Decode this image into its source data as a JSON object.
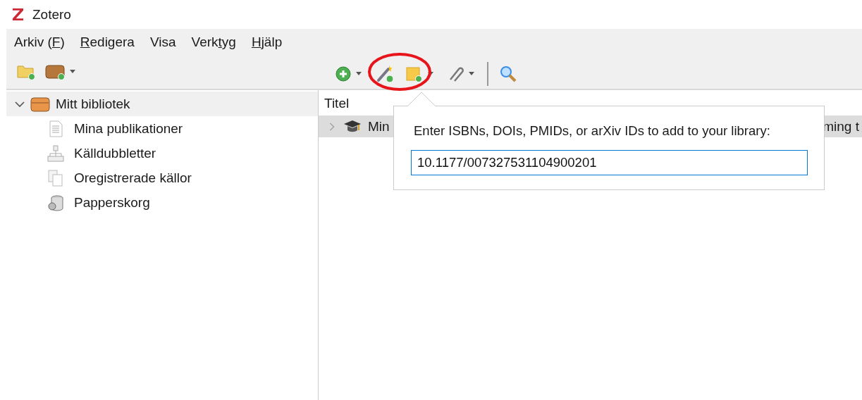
{
  "window": {
    "title": "Zotero"
  },
  "menu": [
    {
      "before": "Arkiv (",
      "key": "F",
      "after": ")"
    },
    {
      "key": "R",
      "after": "edigera"
    },
    {
      "before": "Visa"
    },
    {
      "before": "Verk",
      "key": "t",
      "after": "yg"
    },
    {
      "key": "H",
      "after": "jälp"
    }
  ],
  "sidebar": {
    "items": [
      {
        "label": "Mitt bibliotek",
        "kind": "library",
        "expanded": true,
        "selected": true,
        "children": [
          {
            "label": "Mina publikationer",
            "kind": "publications",
            "selected": false
          },
          {
            "label": "Källdubbletter",
            "kind": "duplicates",
            "selected": false
          },
          {
            "label": "Oregistrerade källor",
            "kind": "unfiled",
            "selected": false
          },
          {
            "label": "Papperskorg",
            "kind": "trash",
            "selected": false
          }
        ]
      }
    ]
  },
  "items": {
    "columns": [
      "Titel"
    ],
    "rows": [
      {
        "title_start": "Min",
        "title_end": "ming t",
        "selected": true,
        "expanded": false
      }
    ]
  },
  "popup": {
    "prompt": "Enter ISBNs, DOIs, PMIDs, or arXiv IDs to add to your library:",
    "value": "10.1177/007327531104900201"
  }
}
